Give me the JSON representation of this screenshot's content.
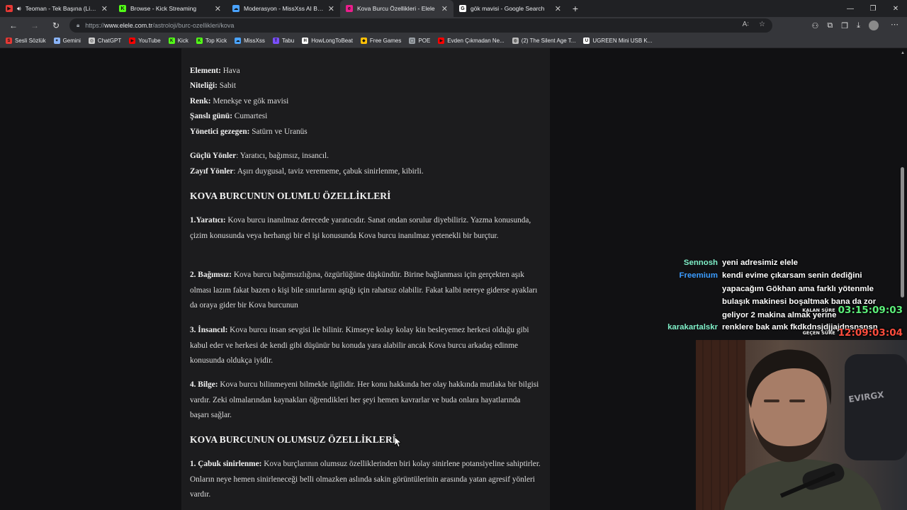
{
  "tabs": [
    {
      "title": "Teoman - Tek Başına (Live) |",
      "favicon_color": "#e53935",
      "favicon": "▶",
      "active": false,
      "audio": true
    },
    {
      "title": "Browse - Kick Streaming",
      "favicon_color": "#53fc18",
      "favicon": "K",
      "active": false
    },
    {
      "title": "Moderasyon - MissXss AI Bot Sys",
      "favicon_color": "#4aa3ff",
      "favicon": "☁",
      "active": false
    },
    {
      "title": "Kova Burcu Özellikleri - Elele",
      "favicon_color": "#e91e8c",
      "favicon": "e",
      "active": true
    },
    {
      "title": "gök mavisi - Google Search",
      "favicon_color": "#ffffff",
      "favicon": "G",
      "active": false
    }
  ],
  "address": {
    "protocol": "https://",
    "host": "www.elele.com.tr",
    "path": "/astroloji/burc-ozellikleri/kova"
  },
  "bookmarks": [
    {
      "label": "Sesli Sözlük",
      "color": "#e53935",
      "icon": "S"
    },
    {
      "label": "Gemini",
      "color": "#8ab4f8",
      "icon": "✦"
    },
    {
      "label": "ChatGPT",
      "color": "#cccccc",
      "icon": "◎"
    },
    {
      "label": "YouTube",
      "color": "#ff0000",
      "icon": "▶"
    },
    {
      "label": "Kick",
      "color": "#53fc18",
      "icon": "K"
    },
    {
      "label": "Top Kick",
      "color": "#53fc18",
      "icon": "K"
    },
    {
      "label": "MissXss",
      "color": "#4aa3ff",
      "icon": "☁"
    },
    {
      "label": "Tabu",
      "color": "#7b4fff",
      "icon": "T"
    },
    {
      "label": "HowLongToBeat",
      "color": "#ffffff",
      "icon": "H"
    },
    {
      "label": "Free Games",
      "color": "#ffc107",
      "icon": "◆"
    },
    {
      "label": "POE",
      "color": "#9aa0a6",
      "icon": "▢"
    },
    {
      "label": "Evden Çıkmadan Ne...",
      "color": "#ff0000",
      "icon": "▶"
    },
    {
      "label": "(2) The Silent Age T...",
      "color": "#bbbbbb",
      "icon": "◍"
    },
    {
      "label": "UGREEN Mini USB K...",
      "color": "#ffffff",
      "icon": "U"
    }
  ],
  "article": {
    "facts": [
      {
        "k": "Element:",
        "v": " Hava"
      },
      {
        "k": "Niteliği:",
        "v": " Sabit"
      },
      {
        "k": "Renk:",
        "v": " Menekşe ve gök mavisi"
      },
      {
        "k": "Şanslı günü:",
        "v": " Cumartesi"
      },
      {
        "k": "Yönetici gezegen:",
        "v": " Satürn ve Uranüs"
      }
    ],
    "traits": [
      {
        "k": "Güçlü Yönler",
        "v": ": Yaratıcı, bağımsız, insancıl."
      },
      {
        "k": "Zayıf Yönler",
        "v": ": Aşırı duygusal, taviz verememe, çabuk sinirlenme, kibirli."
      }
    ],
    "heading_positive": "KOVA BURCUNUN OLUMLU ÖZELLİKLERİ",
    "positive": [
      {
        "k": "1.Yaratıcı:",
        "v": " Kova burcu inanılmaz derecede yaratıcıdır. Sanat ondan sorulur diyebiliriz. Yazma konusunda, çizim konusunda veya herhangi bir el işi konusunda Kova burcu inanılmaz yetenekli bir burçtur."
      },
      {
        "k": "2. Bağımsız:",
        "v": " Kova burcu bağımsızlığına, özgürlüğüne düşkündür. Birine bağlanması için gerçekten aşık olması lazım fakat bazen o kişi bile sınırlarını aştığı için rahatsız olabilir. Fakat kalbi nereye giderse ayakları da oraya gider bir Kova burcunun"
      },
      {
        "k": "3. İnsancıl:",
        "v": " Kova burcu insan sevgisi ile bilinir. Kimseye kolay kolay kin besleyemez herkesi olduğu gibi kabul eder ve herkesi de kendi gibi düşünür bu konuda yara alabilir ancak Kova burcu arkadaş edinme konusunda oldukça iyidir."
      },
      {
        "k": "4. Bilge:",
        "v": " Kova burcu bilinmeyeni bilmekle ilgilidir. Her konu hakkında her olay hakkında mutlaka bir bilgisi vardır. Zeki olmalarından kaynakları öğrendikleri her şeyi hemen kavrarlar ve buda onlara hayatlarında başarı sağlar."
      }
    ],
    "heading_negative": "KOVA BURCUNUN OLUMSUZ ÖZELLİKLERİ",
    "negative": [
      {
        "k": "1. Çabuk sinirlenme:",
        "v": " Kova burçlarının olumsuz özelliklerinden biri kolay sinirlene potansiyeline sahiptirler. Onların neye hemen sinirleneceği belli olmazken aslında sakin görüntülerinin arasında yatan agresif yönleri vardır."
      }
    ]
  },
  "chat": [
    {
      "user": "Sennosh",
      "user_color": "#7ff0c8",
      "text": "yeni adresimiz elele"
    },
    {
      "user": "Freemium",
      "user_color": "#3b9cff",
      "text": "kendi evime çıkarsam senin dediğini yapacağım Gökhan ama farklı yötenmle bulaşık makinesi boşaltmak bana da zor geliyor 2 makina almak yerine"
    },
    {
      "user": "karakartalskr",
      "user_color": "#7ff0c8",
      "text": "renklere bak amk fkdkdnsjdjjajdnsnsnsn"
    }
  ],
  "timers": [
    {
      "label": "KALAN SÜRE",
      "value": "03:15:09:03",
      "color": "#5cf07a"
    },
    {
      "label": "GEÇEN SÜRE",
      "value": "12:09:03:04",
      "color": "#ff4d3d"
    }
  ]
}
